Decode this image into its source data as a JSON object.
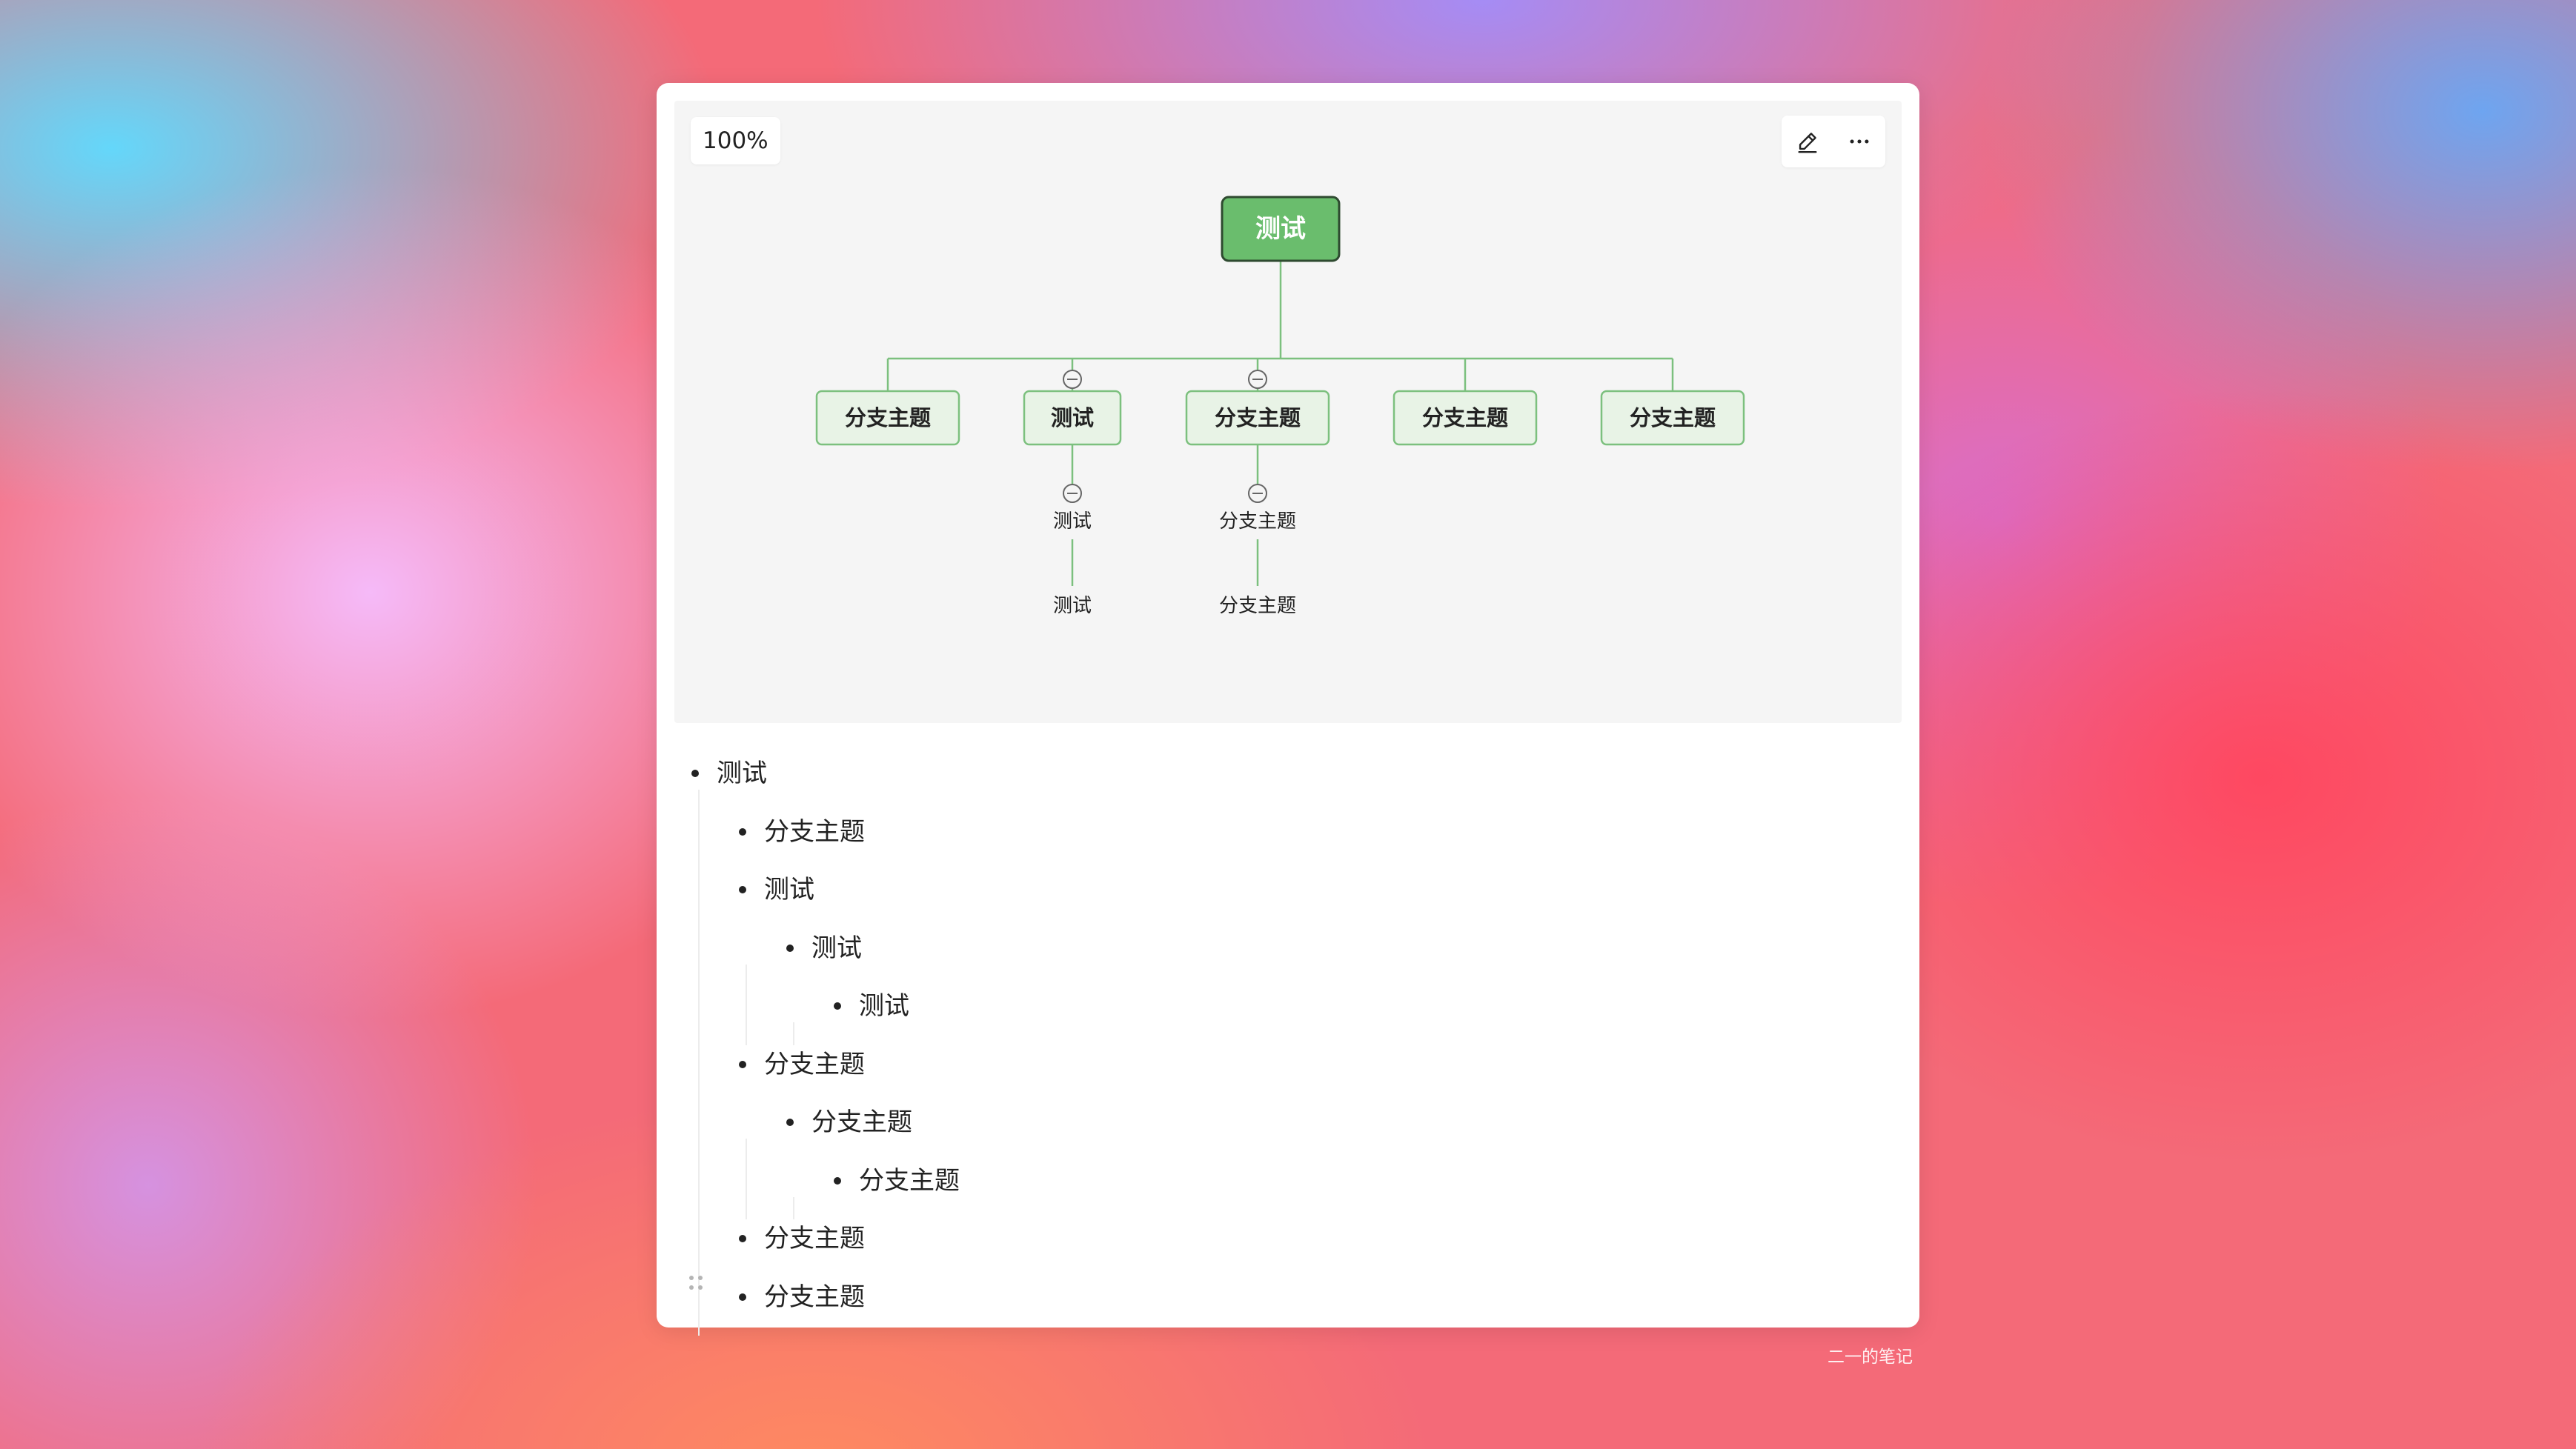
{
  "toolbar": {
    "zoom_label": "100%",
    "edit_icon": "pencil-icon",
    "more_icon": "more-dots-icon"
  },
  "mindmap": {
    "root": "测试",
    "branches": [
      {
        "label": "分支主题",
        "children": []
      },
      {
        "label": "测试",
        "children": [
          {
            "label": "测试",
            "children": [
              {
                "label": "测试"
              }
            ]
          }
        ]
      },
      {
        "label": "分支主题",
        "children": [
          {
            "label": "分支主题",
            "children": [
              {
                "label": "分支主题"
              }
            ]
          }
        ]
      },
      {
        "label": "分支主题",
        "children": []
      },
      {
        "label": "分支主题",
        "children": []
      }
    ],
    "colors": {
      "root_fill": "#6abd6d",
      "root_border": "#2e4a30",
      "branch_fill": "#e8f3e6",
      "branch_border": "#7cc07e",
      "line": "#7cc07e"
    }
  },
  "outline": [
    {
      "text": "测试",
      "level": 0
    },
    {
      "text": "分支主题",
      "level": 1
    },
    {
      "text": "测试",
      "level": 1
    },
    {
      "text": "测试",
      "level": 2
    },
    {
      "text": "测试",
      "level": 3
    },
    {
      "text": "分支主题",
      "level": 1
    },
    {
      "text": "分支主题",
      "level": 2
    },
    {
      "text": "分支主题",
      "level": 3
    },
    {
      "text": "分支主题",
      "level": 1
    },
    {
      "text": "分支主题",
      "level": 1
    }
  ],
  "watermark": "二一的笔记"
}
